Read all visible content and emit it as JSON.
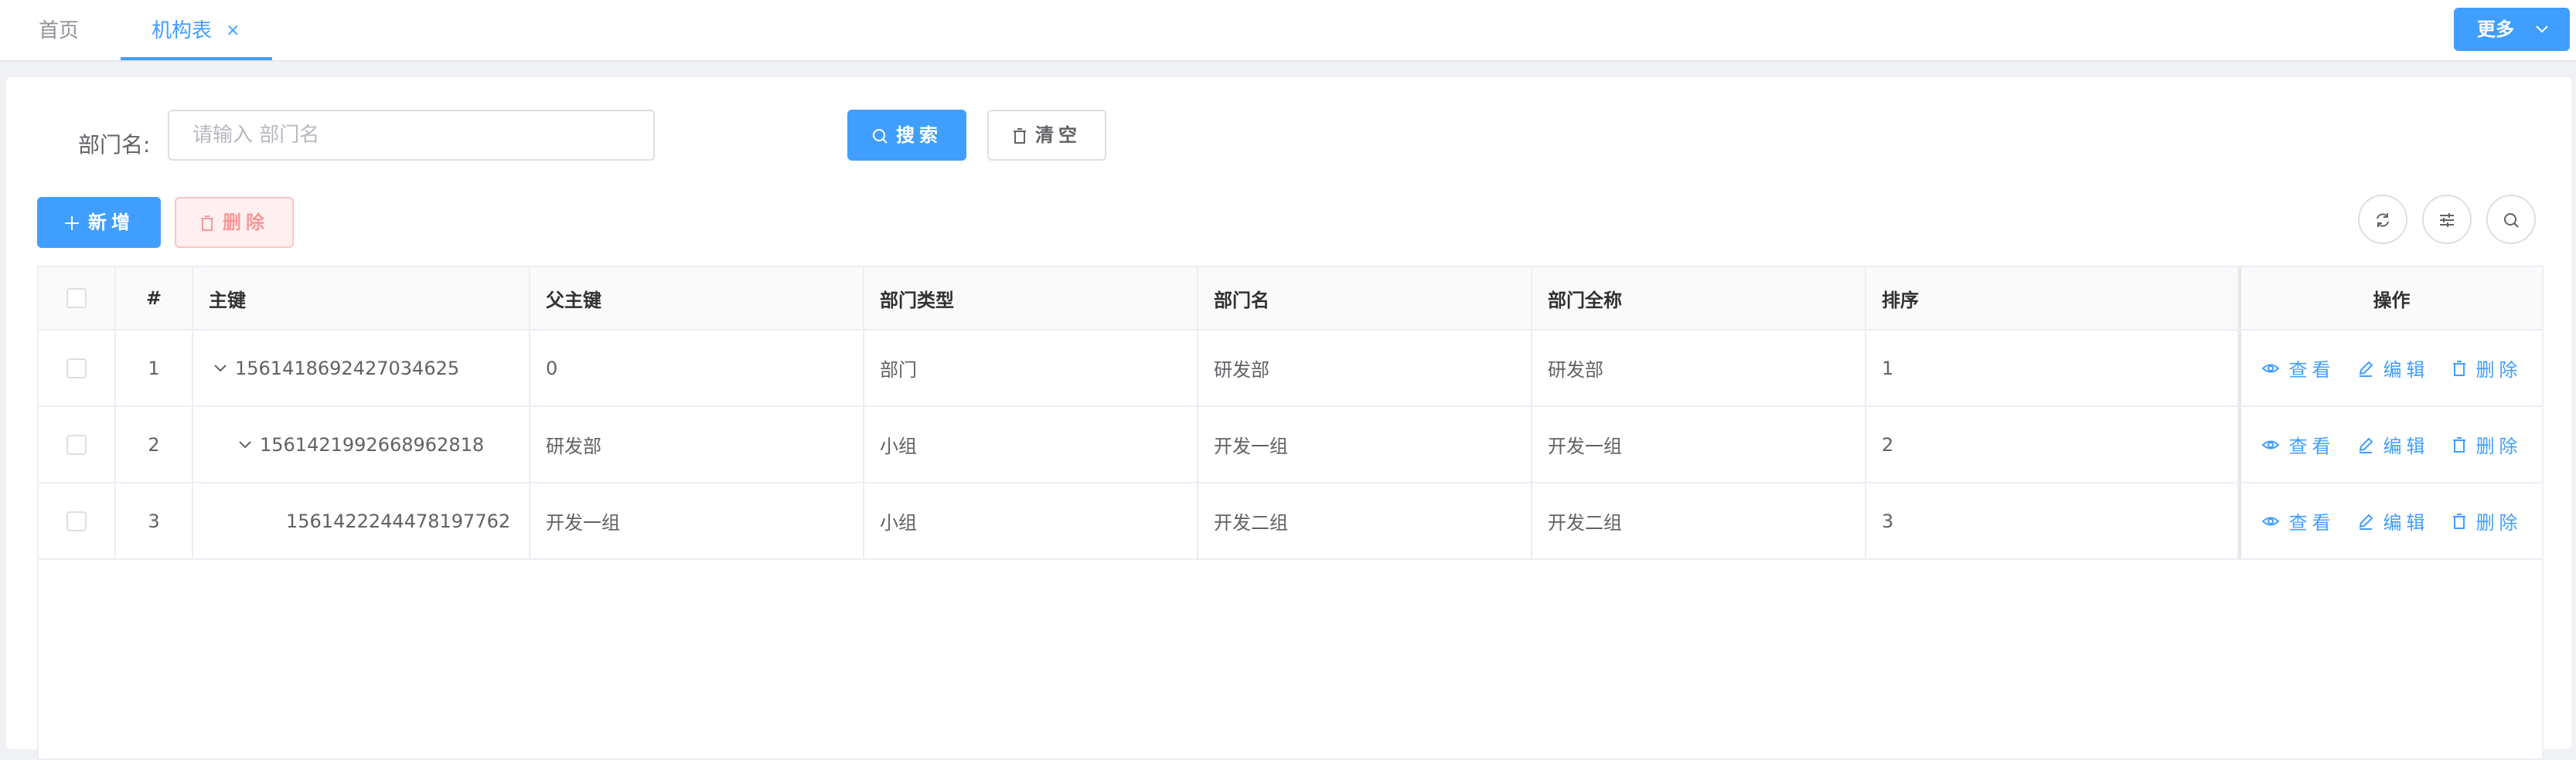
{
  "tabs": {
    "home": "首页",
    "active": "机构表",
    "close": "×",
    "more": "更多"
  },
  "search": {
    "label": "部门名:",
    "placeholder": "请输入 部门名",
    "search_btn": "搜索",
    "clear_btn": "清空"
  },
  "toolbar": {
    "add_btn": "新增",
    "delete_btn": "删除"
  },
  "table": {
    "columns": {
      "index": "#",
      "id": "主键",
      "parent": "父主键",
      "type": "部门类型",
      "name": "部门名",
      "full_name": "部门全称",
      "sort": "排序",
      "ops": "操作"
    },
    "rows": [
      {
        "index": "1",
        "id": "1561418692427034625",
        "parent": "0",
        "type": "部门",
        "name": "研发部",
        "full_name": "研发部",
        "sort": "1"
      },
      {
        "index": "2",
        "id": "1561421992668962818",
        "parent": "研发部",
        "type": "小组",
        "name": "开发一组",
        "full_name": "开发一组",
        "sort": "2"
      },
      {
        "index": "3",
        "id": "1561422244478197762",
        "parent": "开发一组",
        "type": "小组",
        "name": "开发二组",
        "full_name": "开发二组",
        "sort": "3"
      }
    ],
    "actions": {
      "view": "查看",
      "edit": "编辑",
      "delete": "删除"
    }
  },
  "colors": {
    "primary": "#409eff",
    "danger_bg": "#fef0f0",
    "danger_text": "#f89898"
  },
  "icons": [
    "close-icon",
    "chevron-down-icon",
    "search-icon",
    "trash-icon",
    "plus-icon",
    "refresh-icon",
    "sliders-icon",
    "eye-icon",
    "edit-icon"
  ]
}
